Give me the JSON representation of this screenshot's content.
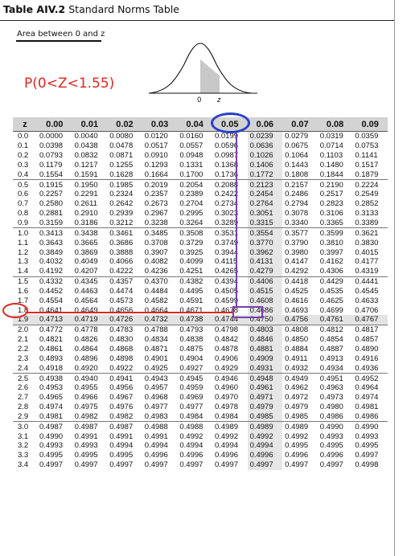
{
  "header": {
    "label": "Table AIV.2",
    "title": "Standard Norms Table"
  },
  "area_caption": "Area between 0 and z",
  "annotation": "P(0<Z<1.55)",
  "curve": {
    "zero_label": "0",
    "z_label": "z"
  },
  "colors": {
    "annotation_red": "#e0271f",
    "circle_blue": "#2a3fc9",
    "box_purple": "#7a3fb1",
    "header_gray": "#d3d3d3"
  },
  "table": {
    "headers": [
      "z",
      "0.00",
      "0.01",
      "0.02",
      "0.03",
      "0.04",
      "0.05",
      "0.06",
      "0.07",
      "0.08",
      "0.09"
    ],
    "rows": [
      [
        "0.0",
        "0.0000",
        "0.0040",
        "0.0080",
        "0.0120",
        "0.0160",
        "0.0199",
        "0.0239",
        "0.0279",
        "0.0319",
        "0.0359"
      ],
      [
        "0.1",
        "0.0398",
        "0.0438",
        "0.0478",
        "0.0517",
        "0.0557",
        "0.0596",
        "0.0636",
        "0.0675",
        "0.0714",
        "0.0753"
      ],
      [
        "0.2",
        "0.0793",
        "0.0832",
        "0.0871",
        "0.0910",
        "0.0948",
        "0.0987",
        "0.1026",
        "0.1064",
        "0.1103",
        "0.1141"
      ],
      [
        "0.3",
        "0.1179",
        "0.1217",
        "0.1255",
        "0.1293",
        "0.1331",
        "0.1368",
        "0.1406",
        "0.1443",
        "0.1480",
        "0.1517"
      ],
      [
        "0.4",
        "0.1554",
        "0.1591",
        "0.1628",
        "0.1664",
        "0.1700",
        "0.1736",
        "0.1772",
        "0.1808",
        "0.1844",
        "0.1879"
      ],
      [
        "0.5",
        "0.1915",
        "0.1950",
        "0.1985",
        "0.2019",
        "0.2054",
        "0.2088",
        "0.2123",
        "0.2157",
        "0.2190",
        "0.2224"
      ],
      [
        "0.6",
        "0.2257",
        "0.2291",
        "0.2324",
        "0.2357",
        "0.2389",
        "0.2422",
        "0.2454",
        "0.2486",
        "0.2517",
        "0.2549"
      ],
      [
        "0.7",
        "0.2580",
        "0.2611",
        "0.2642",
        "0.2673",
        "0.2704",
        "0.2734",
        "0.2764",
        "0.2794",
        "0.2823",
        "0.2852"
      ],
      [
        "0.8",
        "0.2881",
        "0.2910",
        "0.2939",
        "0.2967",
        "0.2995",
        "0.3023",
        "0.3051",
        "0.3078",
        "0.3106",
        "0.3133"
      ],
      [
        "0.9",
        "0.3159",
        "0.3186",
        "0.3212",
        "0.3238",
        "0.3264",
        "0.3289",
        "0.3315",
        "0.3340",
        "0.3365",
        "0.3389"
      ],
      [
        "1.0",
        "0.3413",
        "0.3438",
        "0.3461",
        "0.3485",
        "0.3508",
        "0.3531",
        "0.3554",
        "0.3577",
        "0.3599",
        "0.3621"
      ],
      [
        "1.1",
        "0.3643",
        "0.3665",
        "0.3686",
        "0.3708",
        "0.3729",
        "0.3749",
        "0.3770",
        "0.3790",
        "0.3810",
        "0.3830"
      ],
      [
        "1.2",
        "0.3849",
        "0.3869",
        "0.3888",
        "0.3907",
        "0.3925",
        "0.3944",
        "0.3962",
        "0.3980",
        "0.3997",
        "0.4015"
      ],
      [
        "1.3",
        "0.4032",
        "0.4049",
        "0.4066",
        "0.4082",
        "0.4099",
        "0.4115",
        "0.4131",
        "0.4147",
        "0.4162",
        "0.4177"
      ],
      [
        "1.4",
        "0.4192",
        "0.4207",
        "0.4222",
        "0.4236",
        "0.4251",
        "0.4265",
        "0.4279",
        "0.4292",
        "0.4306",
        "0.4319"
      ],
      [
        "1.5",
        "0.4332",
        "0.4345",
        "0.4357",
        "0.4370",
        "0.4382",
        "0.4394",
        "0.4406",
        "0.4418",
        "0.4429",
        "0.4441"
      ],
      [
        "1.6",
        "0.4452",
        "0.4463",
        "0.4474",
        "0.4484",
        "0.4495",
        "0.4505",
        "0.4515",
        "0.4525",
        "0.4535",
        "0.4545"
      ],
      [
        "1.7",
        "0.4554",
        "0.4564",
        "0.4573",
        "0.4582",
        "0.4591",
        "0.4599",
        "0.4608",
        "0.4616",
        "0.4625",
        "0.4633"
      ],
      [
        "1.8",
        "0.4641",
        "0.4649",
        "0.4656",
        "0.4664",
        "0.4671",
        "0.4678",
        "0.4686",
        "0.4693",
        "0.4699",
        "0.4706"
      ],
      [
        "1.9",
        "0.4713",
        "0.4719",
        "0.4726",
        "0.4732",
        "0.4738",
        "0.4744",
        "0.4750",
        "0.4756",
        "0.4761",
        "0.4767"
      ],
      [
        "2.0",
        "0.4772",
        "0.4778",
        "0.4783",
        "0.4788",
        "0.4793",
        "0.4798",
        "0.4803",
        "0.4808",
        "0.4812",
        "0.4817"
      ],
      [
        "2.1",
        "0.4821",
        "0.4826",
        "0.4830",
        "0.4834",
        "0.4838",
        "0.4842",
        "0.4846",
        "0.4850",
        "0.4854",
        "0.4857"
      ],
      [
        "2.2",
        "0.4861",
        "0.4864",
        "0.4868",
        "0.4871",
        "0.4875",
        "0.4878",
        "0.4881",
        "0.4884",
        "0.4887",
        "0.4890"
      ],
      [
        "2.3",
        "0.4893",
        "0.4896",
        "0.4898",
        "0.4901",
        "0.4904",
        "0.4906",
        "0.4909",
        "0.4911",
        "0.4913",
        "0.4916"
      ],
      [
        "2.4",
        "0.4918",
        "0.4920",
        "0.4922",
        "0.4925",
        "0.4927",
        "0.4929",
        "0.4931",
        "0.4932",
        "0.4934",
        "0.4936"
      ],
      [
        "2.5",
        "0.4938",
        "0.4940",
        "0.4941",
        "0.4943",
        "0.4945",
        "0.4946",
        "0.4948",
        "0.4949",
        "0.4951",
        "0.4952"
      ],
      [
        "2.6",
        "0.4953",
        "0.4955",
        "0.4956",
        "0.4957",
        "0.4959",
        "0.4960",
        "0.4961",
        "0.4962",
        "0.4963",
        "0.4964"
      ],
      [
        "2.7",
        "0.4965",
        "0.4966",
        "0.4967",
        "0.4968",
        "0.4969",
        "0.4970",
        "0.4971",
        "0.4972",
        "0.4973",
        "0.4974"
      ],
      [
        "2.8",
        "0.4974",
        "0.4975",
        "0.4976",
        "0.4977",
        "0.4977",
        "0.4978",
        "0.4979",
        "0.4979",
        "0.4980",
        "0.4981"
      ],
      [
        "2.9",
        "0.4981",
        "0.4982",
        "0.4982",
        "0.4983",
        "0.4984",
        "0.4984",
        "0.4985",
        "0.4985",
        "0.4986",
        "0.4986"
      ],
      [
        "3.0",
        "0.4987",
        "0.4987",
        "0.4987",
        "0.4988",
        "0.4988",
        "0.4989",
        "0.4989",
        "0.4989",
        "0.4990",
        "0.4990"
      ],
      [
        "3.1",
        "0.4990",
        "0.4991",
        "0.4991",
        "0.4991",
        "0.4992",
        "0.4992",
        "0.4992",
        "0.4992",
        "0.4993",
        "0.4993"
      ],
      [
        "3.2",
        "0.4993",
        "0.4993",
        "0.4994",
        "0.4994",
        "0.4994",
        "0.4994",
        "0.4994",
        "0.4995",
        "0.4995",
        "0.4995"
      ],
      [
        "3.3",
        "0.4995",
        "0.4995",
        "0.4995",
        "0.4996",
        "0.4996",
        "0.4996",
        "0.4996",
        "0.4996",
        "0.4996",
        "0.4997"
      ],
      [
        "3.4",
        "0.4997",
        "0.4997",
        "0.4997",
        "0.4997",
        "0.4997",
        "0.4997",
        "0.4997",
        "0.4997",
        "0.4997",
        "0.4998"
      ]
    ]
  }
}
